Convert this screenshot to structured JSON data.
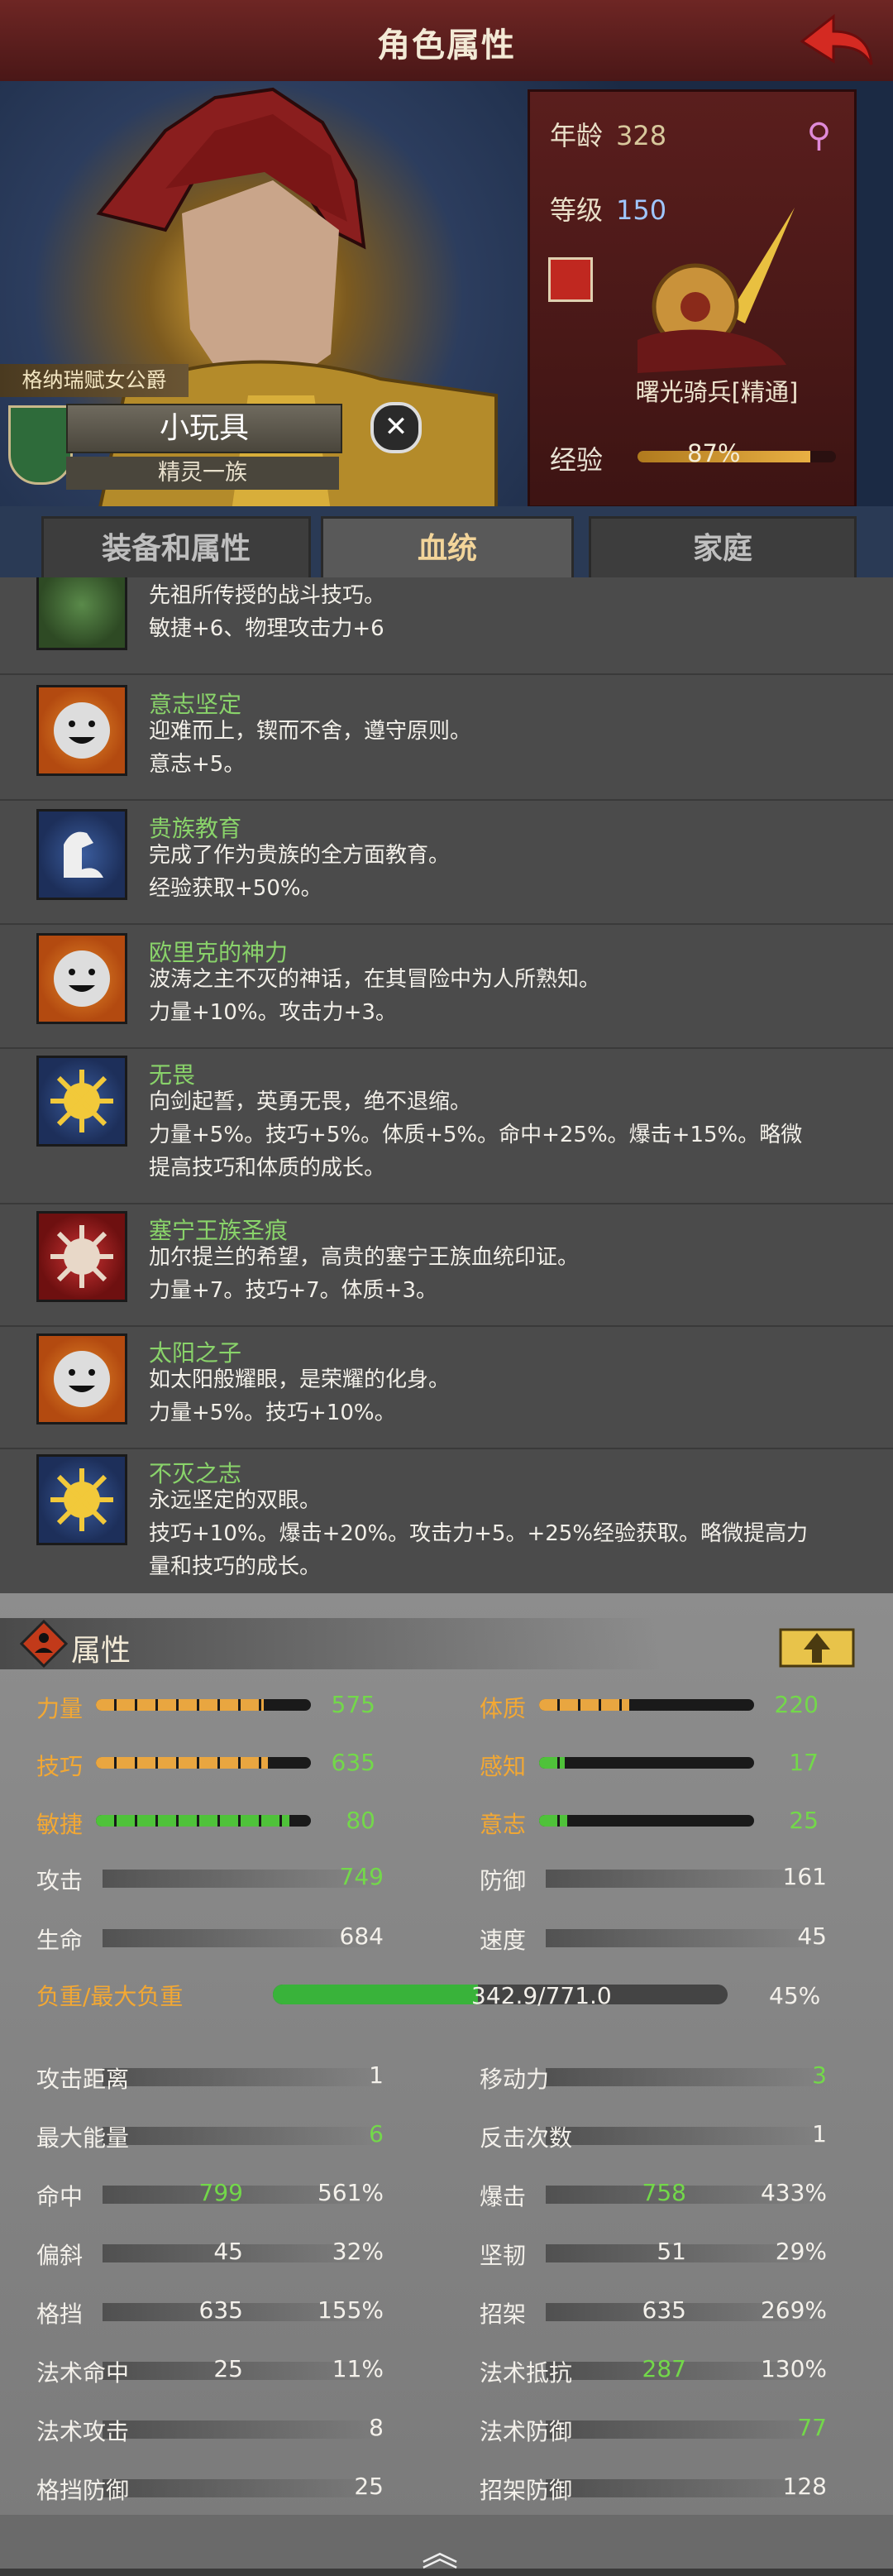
{
  "header": {
    "title": "角色属性",
    "back_icon": "back-arrow-icon"
  },
  "character": {
    "rank": "格纳瑞赋女公爵",
    "name": "小玩具",
    "race": "精灵一族",
    "age_label": "年龄",
    "age": "328",
    "level_label": "等级",
    "level": "150",
    "unit": "曙光骑兵[精通]",
    "exp_label": "经验",
    "exp_percent": "87%",
    "exp_fraction": 0.87
  },
  "tabs": [
    {
      "label": "装备和属性"
    },
    {
      "label": "血统"
    },
    {
      "label": "家庭"
    }
  ],
  "traits": [
    {
      "name": "",
      "desc1": "先祖所传授的战斗技巧。",
      "desc2": "敏捷+6、物理攻击力+6",
      "icon": "hand-flower-icon"
    },
    {
      "name": "意志坚定",
      "desc1": "迎难而上，锲而不舍，遵守原则。",
      "desc2": "意志+5。",
      "icon": "smile-face-icon"
    },
    {
      "name": "贵族教育",
      "desc1": "完成了作为贵族的全方面教育。",
      "desc2": "经验获取+50%。",
      "icon": "arm-flex-icon"
    },
    {
      "name": "欧里克的神力",
      "desc1": "波涛之主不灭的神话，在其冒险中为人所熟知。",
      "desc2": "力量+10%。攻击力+3。",
      "icon": "smile-face-icon"
    },
    {
      "name": "无畏",
      "desc1": "向剑起誓，英勇无畏，绝不退缩。",
      "desc2": "力量+5%。技巧+5%。体质+5%。命中+25%。爆击+15%。略微",
      "desc3": "提高技巧和体质的成长。",
      "icon": "sun-icon"
    },
    {
      "name": "塞宁王族圣痕",
      "desc1": "加尔提兰的希望，高贵的塞宁王族血统印证。",
      "desc2": "力量+7。技巧+7。体质+3。",
      "icon": "sun-red-icon"
    },
    {
      "name": "太阳之子",
      "desc1": "如太阳般耀眼，是荣耀的化身。",
      "desc2": "力量+5%。技巧+10%。",
      "icon": "smile-face-icon"
    },
    {
      "name": "不灭之志",
      "desc1": "永远坚定的双眼。",
      "desc2": "技巧+10%。爆击+20%。攻击力+5。+25%经验获取。略微提高力",
      "desc3": "量和技巧的成长。",
      "icon": "sun-icon"
    }
  ],
  "attributes": {
    "title": "属性",
    "primary": [
      {
        "name": "力量",
        "value": "575",
        "fill": 0.78,
        "color": "orange"
      },
      {
        "name": "体质",
        "value": "220",
        "fill": 0.42,
        "color": "orange"
      },
      {
        "name": "技巧",
        "value": "635",
        "fill": 0.8,
        "color": "orange"
      },
      {
        "name": "感知",
        "value": "17",
        "fill": 0.12,
        "color": "green"
      },
      {
        "name": "敏捷",
        "value": "80",
        "fill": 0.9,
        "color": "green"
      },
      {
        "name": "意志",
        "value": "25",
        "fill": 0.13,
        "color": "green"
      }
    ],
    "secondary": [
      {
        "name": "攻击",
        "value": "749"
      },
      {
        "name": "防御",
        "value": "161"
      },
      {
        "name": "生命",
        "value": "684"
      },
      {
        "name": "速度",
        "value": "45"
      }
    ],
    "load_label": "负重/最大负重",
    "load_value": "342.9/771.0",
    "load_percent": "45%",
    "load_fraction": 0.45,
    "tertiary": [
      {
        "name": "攻击距离",
        "value": "1",
        "pct": ""
      },
      {
        "name": "移动力",
        "value": "3",
        "pct": ""
      },
      {
        "name": "最大能量",
        "value": "6",
        "pct": ""
      },
      {
        "name": "反击次数",
        "value": "1",
        "pct": ""
      },
      {
        "name": "命中",
        "value": "799",
        "pct": "561%"
      },
      {
        "name": "爆击",
        "value": "758",
        "pct": "433%"
      },
      {
        "name": "偏斜",
        "value": "45",
        "pct": "32%"
      },
      {
        "name": "坚韧",
        "value": "51",
        "pct": "29%"
      },
      {
        "name": "格挡",
        "value": "635",
        "pct": "155%"
      },
      {
        "name": "招架",
        "value": "635",
        "pct": "269%"
      },
      {
        "name": "法术命中",
        "value": "25",
        "pct": "11%"
      },
      {
        "name": "法术抵抗",
        "value": "287",
        "pct": "130%"
      },
      {
        "name": "法术攻击",
        "value": "8",
        "pct": ""
      },
      {
        "name": "法术防御",
        "value": "77",
        "pct": ""
      },
      {
        "name": "格挡防御",
        "value": "25",
        "pct": ""
      },
      {
        "name": "招架防御",
        "value": "128",
        "pct": ""
      }
    ]
  },
  "colors": {
    "title_bar": "#5a1e1d",
    "trait_name": "#89d36a",
    "stat_yellow": "#f3a833",
    "stat_green": "#73d84a"
  }
}
